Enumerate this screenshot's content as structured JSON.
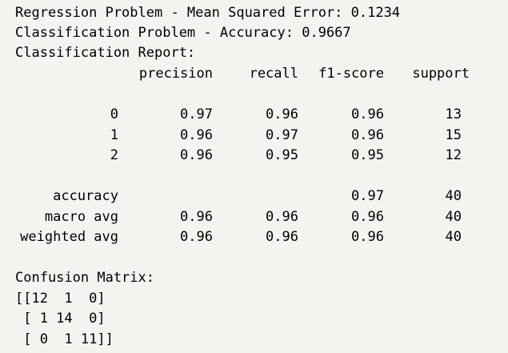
{
  "output": {
    "regression_line": "Regression Problem - Mean Squared Error: 0.1234",
    "classification_line": "Classification Problem - Accuracy: 0.9667",
    "report_title": "Classification Report:",
    "report": {
      "headers": [
        "precision",
        "recall",
        "f1-score",
        "support"
      ],
      "rows": [
        {
          "label": "0",
          "precision": "0.97",
          "recall": "0.96",
          "f1": "0.96",
          "support": "13"
        },
        {
          "label": "1",
          "precision": "0.96",
          "recall": "0.97",
          "f1": "0.96",
          "support": "15"
        },
        {
          "label": "2",
          "precision": "0.96",
          "recall": "0.95",
          "f1": "0.95",
          "support": "12"
        }
      ],
      "summary": [
        {
          "label": "accuracy",
          "precision": "",
          "recall": "",
          "f1": "0.97",
          "support": "40"
        },
        {
          "label": "macro avg",
          "precision": "0.96",
          "recall": "0.96",
          "f1": "0.96",
          "support": "40"
        },
        {
          "label": "weighted avg",
          "precision": "0.96",
          "recall": "0.96",
          "f1": "0.96",
          "support": "40"
        }
      ]
    },
    "confusion_title": "Confusion Matrix:",
    "confusion_lines": [
      "[[12  1  0]",
      " [ 1 14  0]",
      " [ 0  1 11]]"
    ]
  }
}
